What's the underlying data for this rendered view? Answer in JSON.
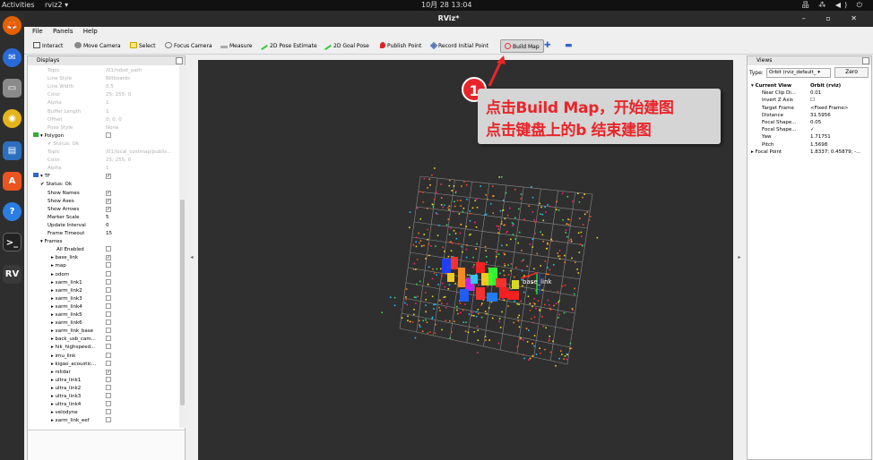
{
  "system": {
    "activities": "Activities",
    "app": "rviz2 ▾",
    "clock": "10月 28  13:04",
    "tray": "品 ⁂ ◀) ⏻"
  },
  "window": {
    "title": "RViz*",
    "controls": "– ▫ ✕"
  },
  "menu": [
    "File",
    "Panels",
    "Help"
  ],
  "toolbar": [
    "Interact",
    "Move Camera",
    "Select",
    "Focus Camera",
    "Measure",
    "2D Pose Estimate",
    "2D Goal Pose",
    "Publish Point",
    "Record Initial Point",
    "Build Map"
  ],
  "displays": {
    "title": "Displays",
    "rows": [
      {
        "k": "Topic",
        "v": "/01/robot_path",
        "grey": true,
        "i": 22
      },
      {
        "k": "Line Style",
        "v": "Billboards",
        "grey": true,
        "i": 22
      },
      {
        "k": "Line Width",
        "v": "0.5",
        "grey": true,
        "i": 22
      },
      {
        "k": "Color",
        "v": "25; 255; 0",
        "grey": true,
        "i": 22
      },
      {
        "k": "Alpha",
        "v": "1",
        "grey": true,
        "i": 22
      },
      {
        "k": "Buffer Length",
        "v": "1",
        "grey": true,
        "i": 22
      },
      {
        "k": "Offset",
        "v": "0; 0; 0",
        "grey": true,
        "i": 22
      },
      {
        "k": "Pose Style",
        "v": "None",
        "grey": true,
        "i": 22
      },
      {
        "k": "▾ Polygon",
        "v": "",
        "grey": false,
        "i": 4,
        "chk": "",
        "ico": "#3a3"
      },
      {
        "k": "✔ Status: Ok",
        "v": "",
        "grey": true,
        "i": 22
      },
      {
        "k": "Topic",
        "v": "/01/local_costmap/publis...",
        "grey": true,
        "i": 22
      },
      {
        "k": "Color",
        "v": "25; 255; 0",
        "grey": true,
        "i": 22
      },
      {
        "k": "Alpha",
        "v": "1",
        "grey": true,
        "i": 22
      },
      {
        "k": "▾ TF",
        "v": "",
        "grey": false,
        "i": 4,
        "chk": "✓",
        "ico": "#36c"
      },
      {
        "k": "✔ Status: Ok",
        "v": "",
        "grey": false,
        "i": 14
      },
      {
        "k": "Show Names",
        "v": "",
        "grey": false,
        "i": 22,
        "chk": "✓"
      },
      {
        "k": "Show Axes",
        "v": "",
        "grey": false,
        "i": 22,
        "chk": "✓"
      },
      {
        "k": "Show Arrows",
        "v": "",
        "grey": false,
        "i": 22,
        "chk": "✓"
      },
      {
        "k": "Marker Scale",
        "v": "5",
        "grey": false,
        "i": 22
      },
      {
        "k": "Update Interval",
        "v": "0",
        "grey": false,
        "i": 22
      },
      {
        "k": "Frame Timeout",
        "v": "15",
        "grey": false,
        "i": 22
      },
      {
        "k": "▾ Frames",
        "v": "",
        "grey": false,
        "i": 14
      },
      {
        "k": "All Enabled",
        "v": "",
        "grey": false,
        "i": 32,
        "chk": ""
      },
      {
        "k": "▸ base_link",
        "v": "",
        "grey": false,
        "i": 26,
        "chk": "✓"
      },
      {
        "k": "▸ map",
        "v": "",
        "grey": false,
        "i": 26,
        "chk": ""
      },
      {
        "k": "▸ odom",
        "v": "",
        "grey": false,
        "i": 26,
        "chk": ""
      },
      {
        "k": "▸ xarm_link1",
        "v": "",
        "grey": false,
        "i": 26,
        "chk": ""
      },
      {
        "k": "▸ xarm_link2",
        "v": "",
        "grey": false,
        "i": 26,
        "chk": ""
      },
      {
        "k": "▸ xarm_link3",
        "v": "",
        "grey": false,
        "i": 26,
        "chk": ""
      },
      {
        "k": "▸ xarm_link4",
        "v": "",
        "grey": false,
        "i": 26,
        "chk": ""
      },
      {
        "k": "▸ xarm_link5",
        "v": "",
        "grey": false,
        "i": 26,
        "chk": ""
      },
      {
        "k": "▸ xarm_link6",
        "v": "",
        "grey": false,
        "i": 26,
        "chk": ""
      },
      {
        "k": "▸ xarm_link_base",
        "v": "",
        "grey": false,
        "i": 26,
        "chk": ""
      },
      {
        "k": "▸ back_usb_cam...",
        "v": "",
        "grey": false,
        "i": 26,
        "chk": ""
      },
      {
        "k": "▸ hik_highspeed...",
        "v": "",
        "grey": false,
        "i": 26,
        "chk": ""
      },
      {
        "k": "▸ imu_link",
        "v": "",
        "grey": false,
        "i": 26,
        "chk": ""
      },
      {
        "k": "▸ kigao_acoustic...",
        "v": "",
        "grey": false,
        "i": 26,
        "chk": ""
      },
      {
        "k": "▸ rslidar",
        "v": "",
        "grey": false,
        "i": 26,
        "chk": "✓"
      },
      {
        "k": "▸ ultra_link1",
        "v": "",
        "grey": false,
        "i": 26,
        "chk": ""
      },
      {
        "k": "▸ ultra_link2",
        "v": "",
        "grey": false,
        "i": 26,
        "chk": ""
      },
      {
        "k": "▸ ultra_link3",
        "v": "",
        "grey": false,
        "i": 26,
        "chk": ""
      },
      {
        "k": "▸ ultra_link4",
        "v": "",
        "grey": false,
        "i": 26,
        "chk": ""
      },
      {
        "k": "▸ velodyne",
        "v": "",
        "grey": false,
        "i": 26,
        "chk": ""
      },
      {
        "k": "▸ xarm_link_eef",
        "v": "",
        "grey": false,
        "i": 26,
        "chk": ""
      }
    ]
  },
  "views": {
    "title": "Views",
    "type_label": "Type:",
    "type_value": "Orbit (rviz_default_ ▾",
    "zero": "Zero",
    "rows": [
      {
        "k": "▾ Current View",
        "v": "Orbit (rviz)",
        "b": true
      },
      {
        "k": "Near Clip Di...",
        "v": "0.01"
      },
      {
        "k": "Invert Z Axis",
        "v": "☐"
      },
      {
        "k": "Target Frame",
        "v": "<Fixed Frame>"
      },
      {
        "k": "Distance",
        "v": "31.5956"
      },
      {
        "k": "Focal Shape...",
        "v": "0.05"
      },
      {
        "k": "Focal Shape...",
        "v": "✓"
      },
      {
        "k": "Yaw",
        "v": "1.71751"
      },
      {
        "k": "Pitch",
        "v": "1.5698"
      },
      {
        "k": "▸ Focal Point",
        "v": "1.8337; 0.45879; -..."
      }
    ]
  },
  "viewport": {
    "frame_label": "base_link"
  },
  "callout": {
    "badge": "1",
    "line1": "点击Build Map，开始建图",
    "line2": "点击键盘上的b 结束建图"
  },
  "panel_arrows": {
    "left": "◂",
    "right": "▸"
  }
}
